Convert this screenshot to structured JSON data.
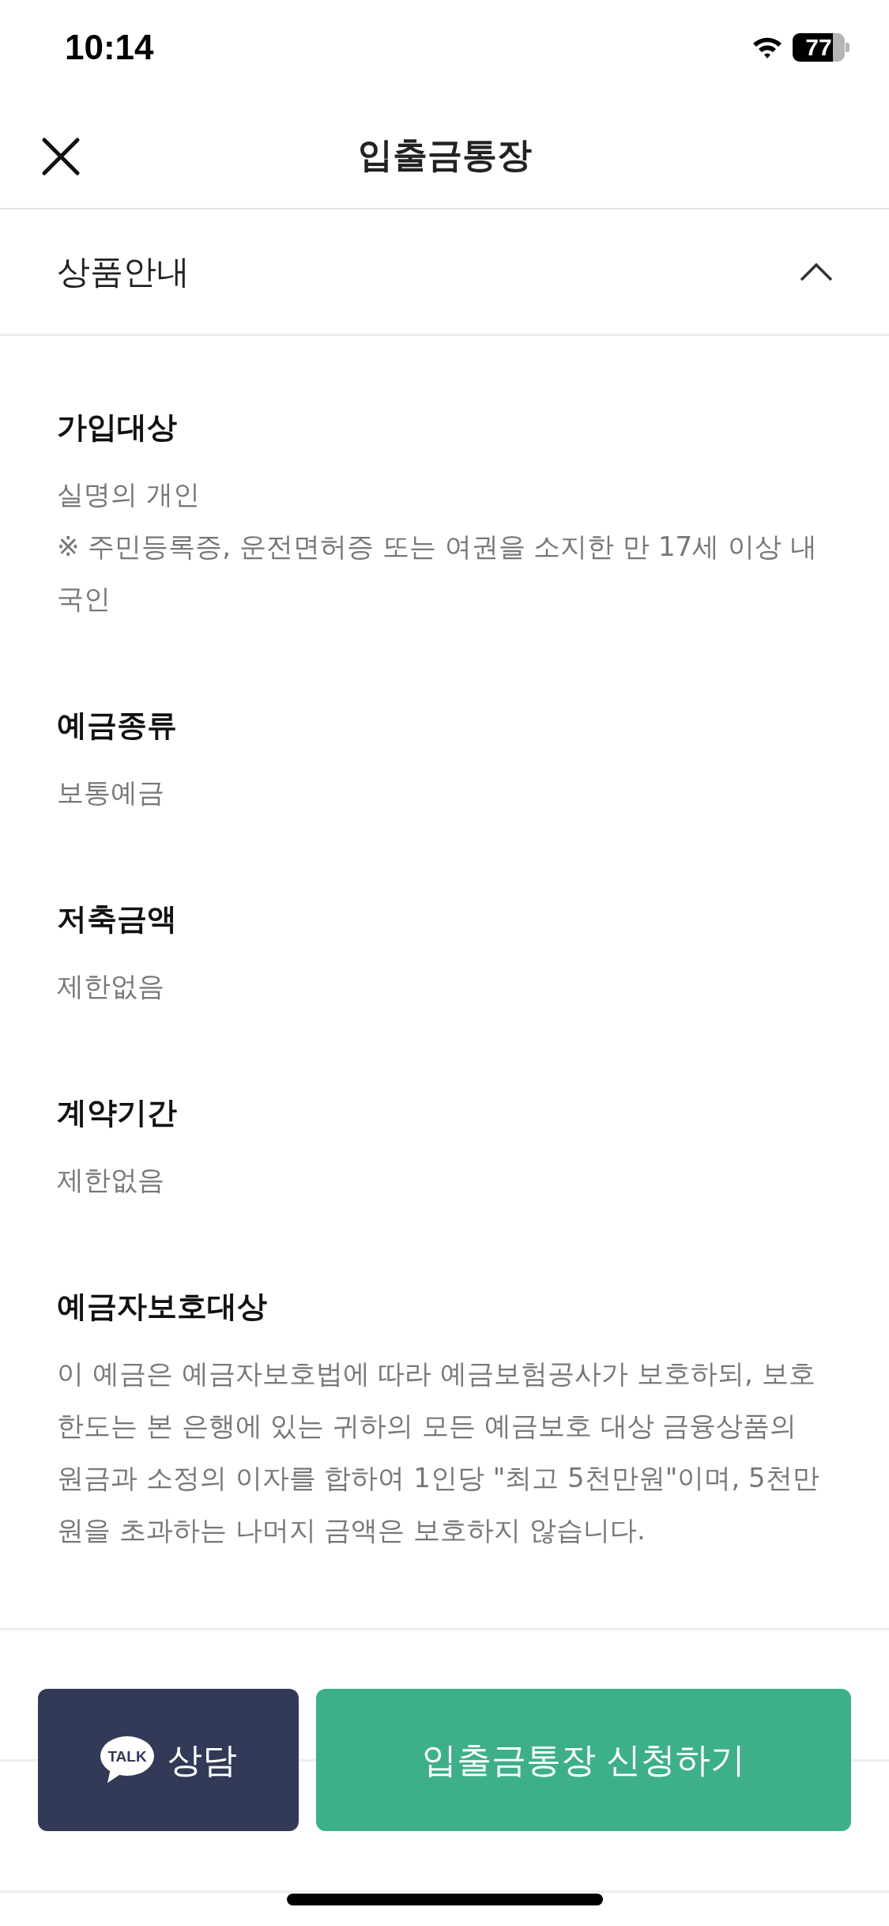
{
  "status_bar": {
    "time": "10:14",
    "battery": "77"
  },
  "header": {
    "title": "입출금통장"
  },
  "accordion": {
    "title": "상품안내",
    "expanded": true,
    "sections": [
      {
        "title": "가입대상",
        "lines": [
          "실명의 개인",
          "※ 주민등록증, 운전면허증 또는 여권을 소지한 만 17세 이상 내국인"
        ]
      },
      {
        "title": "예금종류",
        "lines": [
          "보통예금"
        ]
      },
      {
        "title": "저축금액",
        "lines": [
          "제한없음"
        ]
      },
      {
        "title": "계약기간",
        "lines": [
          "제한없음"
        ]
      },
      {
        "title": "예금자보호대상",
        "lines": [
          "이 예금은 예금자보호법에 따라 예금보험공사가 보호하되, 보호한도는 본 은행에 있는 귀하의 모든 예금보호 대상 금융상품의 원금과 소정의 이자를 합하여 1인당 \"최고 5천만원\"이며, 5천만원을 초과하는 나머지 금액은 보호하지 않습니다."
        ]
      }
    ]
  },
  "bottom_bar": {
    "talk_logo": "TALK",
    "consult_button": "상담",
    "apply_button": "입출금통장 신청하기"
  }
}
